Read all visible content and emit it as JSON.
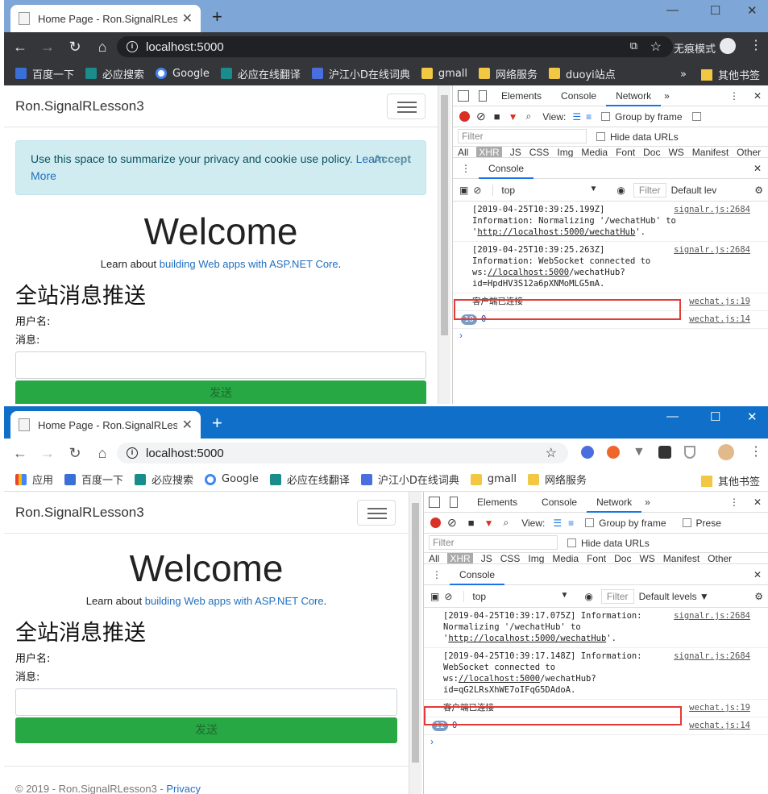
{
  "w1": {
    "tab_title": "Home Page - Ron.SignalRLesso",
    "url": "localhost:5000",
    "incognito_label": "无痕模式",
    "bookmarks": [
      "百度一下",
      "必应搜索",
      "Google",
      "必应在线翻译",
      "沪江小D在线词典",
      "gmall",
      "网络服务",
      "duoyi站点"
    ],
    "more": "»",
    "other_bookmarks": "其他书签",
    "page": {
      "brand": "Ron.SignalRLesson3",
      "alert_text": "Use this space to summarize your privacy and cookie use policy. ",
      "alert_link": "Learn More",
      "accept": "Accept",
      "welcome": "Welcome",
      "learn_prefix": "Learn about ",
      "learn_link": "building Web apps with ASP.NET Core",
      "learn_suffix": ".",
      "heading": "全站消息推送",
      "user_label": "用户名:",
      "msg_label": "消息:",
      "send": "发送"
    },
    "dev": {
      "tabs": [
        "Elements",
        "Console",
        "Network",
        "»"
      ],
      "active_tab": "Network",
      "view_label": "View:",
      "group_by_frame": "Group by frame",
      "filter_placeholder": "Filter",
      "hide_data_urls": "Hide data URLs",
      "types": [
        "All",
        "XHR",
        "JS",
        "CSS",
        "Img",
        "Media",
        "Font",
        "Doc",
        "WS",
        "Manifest",
        "Other"
      ],
      "drawer_tab": "Console",
      "context": "top",
      "filter2": "Filter",
      "levels": "Default lev",
      "logs": [
        {
          "text1": "[2019-04-25T10:39:25.199Z]",
          "text2": "Information: Normalizing '/wechatHub' to '",
          "link": "http://localhost:5000/wechatHub",
          "text3": "'.",
          "src": "signalr.js:2684"
        },
        {
          "text1": "[2019-04-25T10:39:25.263Z]",
          "text2": "Information: WebSocket connected to ws:",
          "link": "//localhost:5000",
          "text3": "/wechatHub?id=HpdHV3S12a6pXNMoMLG5mA.",
          "src": "signalr.js:2684"
        }
      ],
      "connected": "客户端已连接",
      "connected_src": "wechat.js:19",
      "count_badge": "10",
      "count_value": "0",
      "count_src": "wechat.js:14"
    }
  },
  "w2": {
    "tab_title": "Home Page - Ron.SignalRLess",
    "url": "localhost:5000",
    "bookmarks": [
      "应用",
      "百度一下",
      "必应搜索",
      "Google",
      "必应在线翻译",
      "沪江小D在线词典",
      "gmall",
      "网络服务"
    ],
    "other_bookmarks": "其他书签",
    "page": {
      "brand": "Ron.SignalRLesson3",
      "welcome": "Welcome",
      "learn_prefix": "Learn about ",
      "learn_link": "building Web apps with ASP.NET Core",
      "learn_suffix": ".",
      "heading": "全站消息推送",
      "user_label": "用户名:",
      "msg_label": "消息:",
      "send": "发送",
      "footer": "© 2019 - Ron.SignalRLesson3 - ",
      "footer_link": "Privacy"
    },
    "dev": {
      "tabs": [
        "Elements",
        "Console",
        "Network",
        "»"
      ],
      "active_tab": "Network",
      "view_label": "View:",
      "group_by_frame": "Group by frame",
      "preserve": "Prese",
      "filter_placeholder": "Filter",
      "hide_data_urls": "Hide data URLs",
      "types": [
        "All",
        "XHR",
        "JS",
        "CSS",
        "Img",
        "Media",
        "Font",
        "Doc",
        "WS",
        "Manifest",
        "Other"
      ],
      "drawer_tab": "Console",
      "context": "top",
      "filter2": "Filter",
      "levels": "Default levels ▼",
      "logs": [
        {
          "text1": "[2019-04-25T10:39:17.075Z]",
          "text2": "Information: Normalizing '/wechatHub' to '",
          "link": "http://localhost:5000/wechatHub",
          "text3": "'.",
          "src": "signalr.js:2684"
        },
        {
          "text1": "[2019-04-25T10:39:17.148Z]",
          "text2": "Information: WebSocket connected to ws:",
          "link": "//localhost:5000",
          "text3": "/wechatHub?id=qG2LRsXhWE7oIFqG5DAdoA.",
          "src": "signalr.js:2684"
        }
      ],
      "connected": "客户端已连接",
      "connected_src": "wechat.js:19",
      "count_badge": "12",
      "count_value": "0",
      "count_src": "wechat.js:14"
    }
  },
  "colors": {
    "highlight": "#e53935",
    "button": "#28a745",
    "link": "#1f6fbf"
  }
}
